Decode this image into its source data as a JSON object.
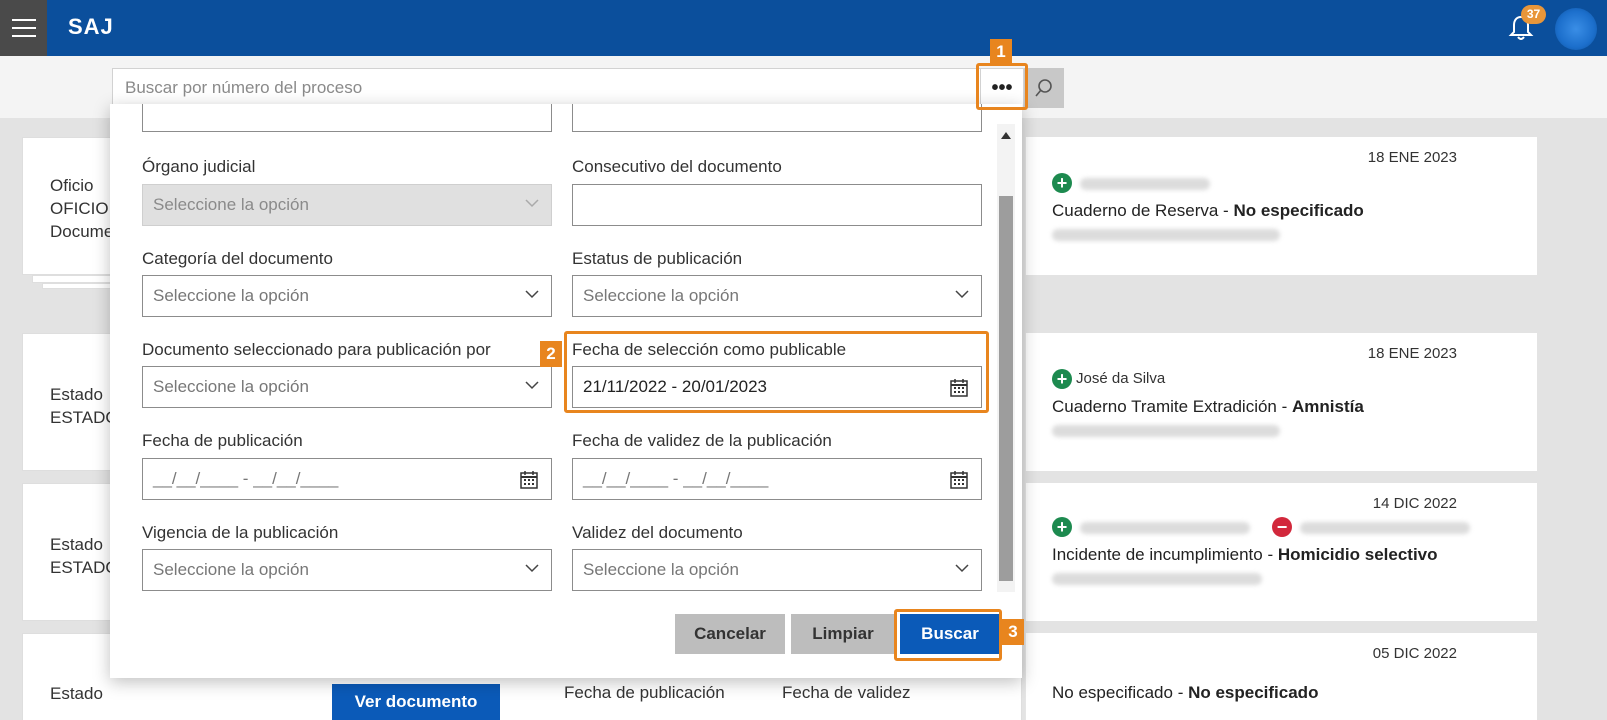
{
  "app": {
    "brand": "SAJ",
    "notification_count": "37"
  },
  "search": {
    "placeholder": "Buscar por número del proceso"
  },
  "icons": {
    "menu": "menu-icon",
    "bell": "bell-icon",
    "more": "more-icon",
    "search": "search-icon",
    "calendar": "calendar-icon",
    "chevron": "chevron-down-icon"
  },
  "colors": {
    "topbar": "#0b4f9c",
    "primary_button": "#0b5ab8",
    "highlight": "#e8851e"
  },
  "modal": {
    "left": [
      {
        "label": "Órgano judicial",
        "value": "Seleccione la opción",
        "type": "select",
        "disabled": true
      },
      {
        "label": "Categoría del documento",
        "value": "Seleccione la opción",
        "type": "select"
      },
      {
        "label": "Documento seleccionado para publicación por",
        "value": "Seleccione la opción",
        "type": "select"
      },
      {
        "label": "Fecha de publicación",
        "value": "__/__/____ - __/__/____",
        "type": "date"
      },
      {
        "label": "Vigencia de la publicación",
        "value": "Seleccione la opción",
        "type": "select"
      }
    ],
    "right": [
      {
        "label": "Consecutivo del documento",
        "value": "",
        "type": "text"
      },
      {
        "label": "Estatus de publicación",
        "value": "Seleccione la opción",
        "type": "select"
      },
      {
        "label": "Fecha de selección como publicable",
        "value": "21/11/2022 - 20/01/2023",
        "type": "date"
      },
      {
        "label": "Fecha de validez de la publicación",
        "value": "__/__/____ - __/__/____",
        "type": "date"
      },
      {
        "label": "Validez del documento",
        "value": "Seleccione la opción",
        "type": "select"
      }
    ],
    "buttons": {
      "cancel": "Cancelar",
      "clear": "Limpiar",
      "search": "Buscar"
    }
  },
  "callouts": [
    "1",
    "2",
    "3"
  ],
  "cards": [
    {
      "left_lines": [
        "Oficio",
        "OFICIO.",
        "Docume"
      ],
      "date": "18 ENE 2023",
      "person": "",
      "title": "Cuaderno de Reserva",
      "title_bold": "No especificado"
    },
    {
      "left_lines": [
        "Estado",
        "ESTADO"
      ],
      "date": "18 ENE 2023",
      "person": "José da Silva",
      "title": "Cuaderno Tramite Extradición",
      "title_bold": "Amnistía"
    },
    {
      "left_lines": [
        "Estado",
        "ESTADO"
      ],
      "date": "14 DIC 2022",
      "person": "",
      "title": "Incidente de incumplimiento",
      "title_bold": "Homicidio selectivo"
    },
    {
      "left_lines": [
        "Estado"
      ],
      "date": "05 DIC 2022",
      "person": "",
      "title": "No especificado",
      "title_bold": "No especificado"
    }
  ],
  "bottom": {
    "view_button": "Ver documento",
    "col1": "Fecha de publicación",
    "col2": "Fecha de validez"
  },
  "separator": " - "
}
